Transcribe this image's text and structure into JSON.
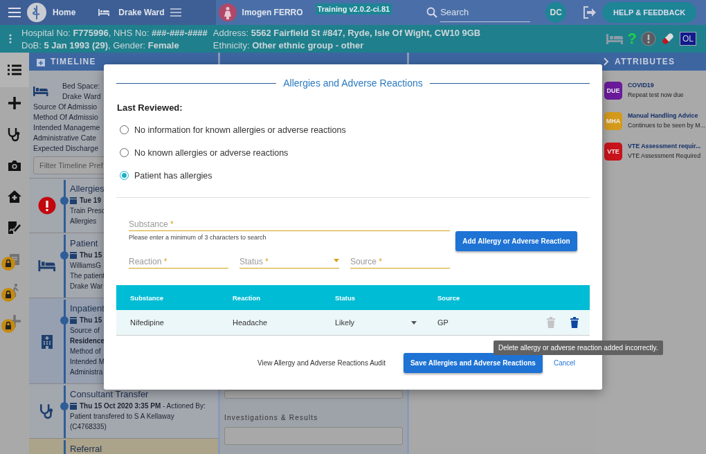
{
  "top_bar": {
    "home": "Home",
    "ward": "Drake Ward",
    "patient": "Imogen FERRO",
    "version": "Training v2.0.2-ci.81",
    "search_placeholder": "Search",
    "user_initials": "DC",
    "help_button": "HELP & FEEDBACK"
  },
  "patient_banner": {
    "left_lines": [
      "Hospital No: **F775996**, NHS No: **###-###-####**",
      "DoB: **5 Jan 1993 (29)**, Gender: **Female**"
    ],
    "right_lines": [
      "Address: **5562 Fairfield St #847, Ryde, Isle Of Wight, CW10 9GB**",
      "Ethnicity: **Other ethnic group - other**"
    ],
    "help_mark": "?",
    "user_badge": "OL"
  },
  "side_rail": [
    {
      "kind": "list",
      "selected": true,
      "locked": false
    },
    {
      "kind": "add",
      "selected": false,
      "locked": false
    },
    {
      "kind": "stethoscope",
      "selected": false,
      "locked": false
    },
    {
      "kind": "camera",
      "selected": false,
      "locked": false
    },
    {
      "kind": "house",
      "selected": false,
      "locked": false
    },
    {
      "kind": "document",
      "selected": false,
      "locked": false
    },
    {
      "kind": "clipboard",
      "selected": false,
      "locked": true
    },
    {
      "kind": "walk",
      "selected": false,
      "locked": true
    },
    {
      "kind": "add",
      "selected": false,
      "locked": true
    }
  ],
  "timeline": {
    "title": "TIMELINE",
    "bed_lines": [
      "Bed Space:",
      "Drake Ward"
    ],
    "summary_fields": [
      "Source Of Admissio",
      "Method Of Admissio",
      "Intended Manageme",
      "Administrative Cate",
      "Expected Discharge"
    ],
    "filter_placeholder": "Filter Timeline Pref",
    "entries": [
      {
        "kind": "alert",
        "title": "Allergies",
        "date": "Tue 19",
        "lines": [
          {
            "text": "Train Presc",
            "bold": false
          },
          {
            "text": "Allergies",
            "bold": false
          }
        ]
      },
      {
        "kind": "bed",
        "title": "Patient",
        "date": "Thu 15",
        "lines": [
          {
            "text": "WilliamsG",
            "bold": false
          },
          {
            "text": "The patient",
            "bold": false
          },
          {
            "text": "Drake War",
            "bold": false
          }
        ]
      },
      {
        "kind": "hospital",
        "title": "Inpatient",
        "date": "Thu 15",
        "lines": [
          {
            "text": "Source of",
            "bold": false
          },
          {
            "text": "Residence",
            "bold": true
          },
          {
            "text": "Method of",
            "bold": false
          },
          {
            "text": "Intended M",
            "bold": false
          },
          {
            "text": "Administra",
            "bold": false
          }
        ]
      },
      {
        "kind": "stethoscope",
        "title": "Consultant Transfer",
        "date": "Thu 15 Oct 2020 3:35 PM",
        "date_note": "- Actioned By:",
        "lines": [
          {
            "text": "Patient transfered to S A Kellaway",
            "bold": false
          },
          {
            "text": "(C4768335)",
            "bold": false
          }
        ]
      },
      {
        "kind": "referral",
        "title": "Referral"
      }
    ]
  },
  "clinical_column": {
    "section_label": "Investigations & Results"
  },
  "attributes": {
    "title": "ATTRIBUTES",
    "items": [
      {
        "badge": "DUE",
        "color": "#6a1b9a",
        "title": "COVID19",
        "subtitle": "Repeat test now due"
      },
      {
        "badge": "MHA",
        "color": "#d49a1c",
        "title": "Manual Handling Advice",
        "subtitle": "Continues to be seen by M..."
      },
      {
        "badge": "VTE",
        "color": "#c8141c",
        "title": "VTE Assessment requir...",
        "subtitle": "VTE Assessment Required"
      }
    ]
  },
  "dialog": {
    "title": "Allergies and Adverse Reactions",
    "last_reviewed": "Last Reviewed:",
    "options": [
      {
        "label": "No information for known allergies or adverse reactions",
        "selected": false
      },
      {
        "label": "No known allergies or adverse reactions",
        "selected": false
      },
      {
        "label": "Patient has allergies",
        "selected": true
      }
    ],
    "substance": {
      "label": "Substance",
      "required_mark": "*",
      "hint": "Please enter a minimum of 3 characters to search"
    },
    "reaction": {
      "label": "Reaction",
      "required_mark": "*"
    },
    "status": {
      "label": "Status",
      "required_mark": "*"
    },
    "source": {
      "label": "Source",
      "required_mark": "*"
    },
    "add_button": "Add Allergy or Adverse Reaction",
    "table": {
      "columns": [
        "Substance",
        "Reaction",
        "Status",
        "Source"
      ],
      "rows": [
        {
          "cells": [
            "Nifedipine",
            "Headache",
            "Likely",
            "GP"
          ],
          "delete_disabled": true
        }
      ]
    },
    "tooltip": "Delete allergy or adverse reaction added incorrectly.",
    "audit_link": "View Allergy and Adverse Reactions Audit",
    "save_button": "Save Allergies and Adverse Reactions",
    "cancel_button": "Cancel"
  }
}
